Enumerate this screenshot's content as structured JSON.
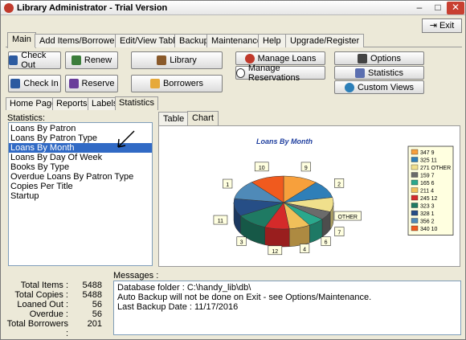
{
  "window": {
    "title": "Library Administrator - Trial Version"
  },
  "exit_label": "Exit",
  "menu_tabs": [
    "Main",
    "Add Items/Borrowers",
    "Edit/View Table",
    "Backup",
    "Maintenance",
    "Help",
    "Upgrade/Register"
  ],
  "buttons": {
    "check_out": "Check Out",
    "renew": "Renew",
    "library": "Library",
    "check_in": "Check In",
    "reserve": "Reserve",
    "borrowers": "Borrowers",
    "manage_loans": "Manage Loans",
    "manage_reservations": "Manage Reservations",
    "options": "Options",
    "statistics": "Statistics",
    "custom_views": "Custom Views"
  },
  "sub_tabs": [
    "Home Page",
    "Reports",
    "Labels",
    "Statistics"
  ],
  "statistics_label": "Statistics:",
  "stat_items": [
    "Loans By Patron",
    "Loans By Patron Type",
    "Loans By Month",
    "Loans By Day Of Week",
    "Books By Type",
    "Overdue Loans By Patron Type",
    "Copies Per Title",
    "Startup"
  ],
  "chart_tabs": [
    "Table",
    "Chart"
  ],
  "messages_label": "Messages :",
  "messages": [
    "Database folder : C:\\handy_lib\\db\\",
    "Auto Backup will not be done on Exit - see Options/Maintenance.",
    "Last Backup Date : 11/17/2016"
  ],
  "totals": [
    {
      "label": "Total Items :",
      "value": "5488"
    },
    {
      "label": "Total Copies :",
      "value": "5488"
    },
    {
      "label": "Loaned Out :",
      "value": "56"
    },
    {
      "label": "Overdue :",
      "value": "56"
    },
    {
      "label": "Total Borrowers :",
      "value": "201"
    }
  ],
  "chart_data": {
    "type": "pie",
    "title": "Loans By Month",
    "slices": [
      {
        "label": "9",
        "value": 347,
        "color": "#f7a03c",
        "legend": "347 9"
      },
      {
        "label": "2",
        "value": 325,
        "color": "#2f7fb8",
        "legend": "325 11"
      },
      {
        "label": "OTHER",
        "value": 271,
        "color": "#f0e08c",
        "legend": "271 OTHER"
      },
      {
        "label": "7",
        "value": 159,
        "color": "#6b6b6b",
        "legend": "159 7"
      },
      {
        "label": "6",
        "value": 165,
        "color": "#2aa88c",
        "legend": "165 6"
      },
      {
        "label": "4",
        "value": 211,
        "color": "#f0c05a",
        "legend": "211 4"
      },
      {
        "label": "12",
        "value": 245,
        "color": "#d42a2a",
        "legend": "245 12"
      },
      {
        "label": "3",
        "value": 323,
        "color": "#1f7a63",
        "legend": "323 3"
      },
      {
        "label": "11",
        "value": 328,
        "color": "#264e86",
        "legend": "328 1"
      },
      {
        "label": "1",
        "value": 356,
        "color": "#4f8ab8",
        "legend": "356 2"
      },
      {
        "label": "10",
        "value": 340,
        "color": "#f05a1e",
        "legend": "340 10"
      }
    ]
  }
}
